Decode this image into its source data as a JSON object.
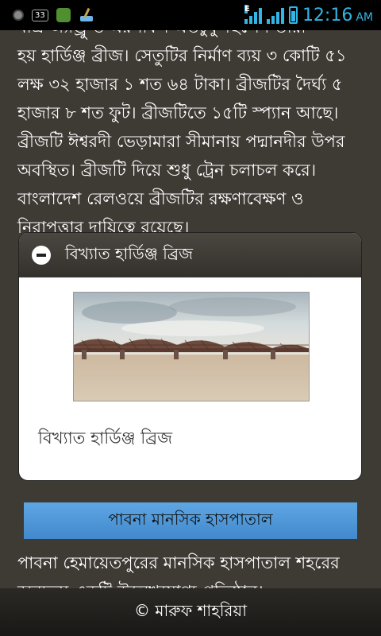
{
  "status_bar": {
    "notification_count": "33",
    "network_type": "E",
    "time": "12:16",
    "ampm": "AM"
  },
  "article": {
    "paragraph_1_line_0": "মাত্র অ্যান্ড্রু ও এরসকিন এতটুকু ছিলেন তারা",
    "paragraph_1_lines": [
      "হয় হার্ডিঞ্জ ব্রীজ। সেতুটির নির্মাণ ব্যয় ৩ কোটি ৫১",
      "লক্ষ ৩২ হাজার ১ শত ৬৪ টাকা। ব্রীজটির দৈর্ঘ্য ৫",
      "হাজার ৮ শত ফুট। ব্রীজটিতে ১৫টি স্প্যান আছে।",
      "ব্রীজটি ঈশ্বরদী ভেড়ামারা সীমানায় পদ্মানদীর উপর",
      "অবস্থিত। ব্রীজটি দিয়ে শুধু ট্রেন চলাচল করে।",
      "বাংলাদেশ রেলওয়ে ব্রীজটির রক্ষণাবেক্ষণ ও",
      "নিরাপত্তার দায়িত্বে রয়েছে।"
    ],
    "card": {
      "header_title": "বিখ্যাত হার্ডিঞ্জ ব্রিজ",
      "image_caption": "বিখ্যাত হার্ডিঞ্জ ব্রিজ",
      "image_icon": "bridge-photo"
    },
    "section_title": "পাবনা মানসিক হাসপাতাল",
    "paragraph_2_lines": [
      "পাবনা হেমায়েতপুরের মানসিক হাসপাতাল শহরের",
      "অন্যতম একটি উল্লেখযোগ্য প্রতিষ্ঠান।"
    ]
  },
  "footer": {
    "copyright": "© মারুফ শাহরিয়া"
  },
  "colors": {
    "status_accent": "#33b5e5",
    "page_background": "#3e3a34",
    "section_banner": "#5ea6e3"
  }
}
